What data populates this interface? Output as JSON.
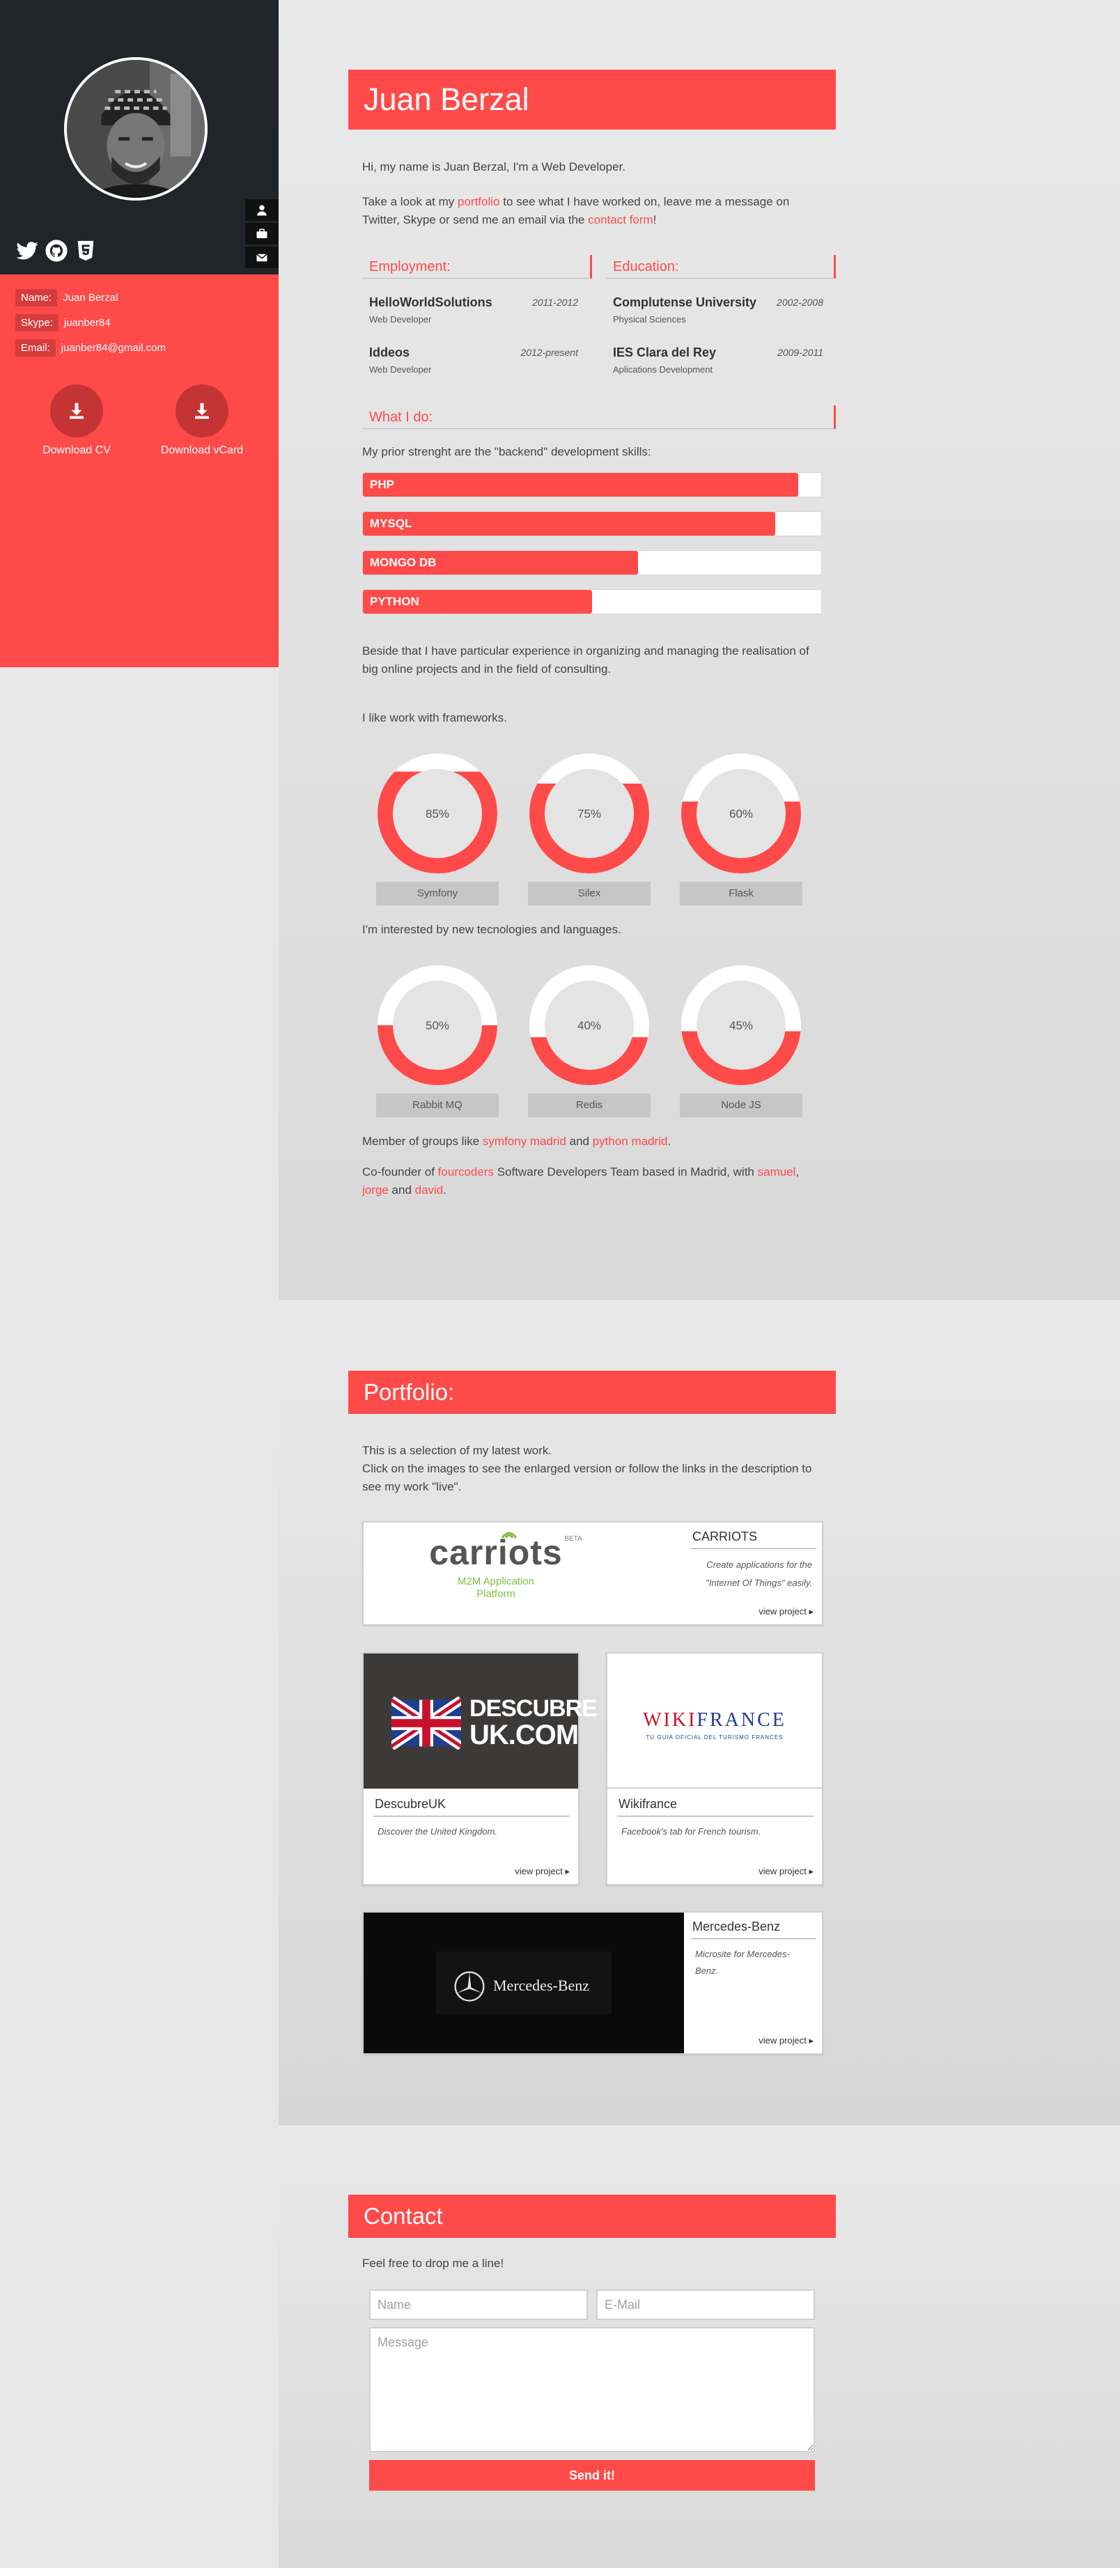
{
  "sidebar": {
    "name_label": "Name:",
    "name_value": "Juan Berzal",
    "skype_label": "Skype:",
    "skype_value": "juanber84",
    "email_label": "Email:",
    "email_value": "juanber84@gmail.com",
    "download_cv": "Download CV",
    "download_vcard": "Download vCard",
    "social_icons": [
      "twitter-icon",
      "github-icon",
      "html5-icon"
    ],
    "nav_icons": [
      "user-icon",
      "briefcase-icon",
      "envelope-icon"
    ]
  },
  "about": {
    "title": "Juan Berzal",
    "intro": "Hi, my name is Juan Berzal, I'm a Web Developer.",
    "take_look_1": "Take a look at my ",
    "take_look_link1": "portfolio",
    "take_look_2": " to see what I have worked on, leave me a message on Twitter, Skype or send me an email via the ",
    "take_look_link2": "contact form",
    "take_look_3": "!",
    "employment_heading": "Employment:",
    "education_heading": "Education:",
    "employment": [
      {
        "title": "HelloWorldSolutions",
        "years": "2011-2012",
        "role": "Web Developer"
      },
      {
        "title": "Iddeos",
        "years": "2012-present",
        "role": "Web Developer"
      }
    ],
    "education": [
      {
        "title": "Complutense University",
        "years": "2002-2008",
        "role": "Physical Sciences"
      },
      {
        "title": "IES Clara del Rey",
        "years": "2009-2011",
        "role": "Aplications Development"
      }
    ],
    "whatido_heading": "What I do:",
    "skills_intro": "My prior strenght are the \"backend\" development skills:",
    "skills": [
      {
        "name": "PHP",
        "percent": 95
      },
      {
        "name": "MYSQL",
        "percent": 90
      },
      {
        "name": "MONGO DB",
        "percent": 60
      },
      {
        "name": "PYTHON",
        "percent": 50
      }
    ],
    "experience": "Beside that I have particular experience in organizing and managing the realisation of big online projects and in the field of consulting.",
    "frameworks_intro": "I like work with frameworks.",
    "frameworks": [
      {
        "name": "Symfony",
        "percent_label": "85%",
        "percent": 85
      },
      {
        "name": "Silex",
        "percent_label": "75%",
        "percent": 75
      },
      {
        "name": "Flask",
        "percent_label": "60%",
        "percent": 60
      }
    ],
    "new_tech_intro": "I'm interested by new tecnologies and languages.",
    "new_tech": [
      {
        "name": "Rabbit MQ",
        "percent_label": "50%",
        "percent": 50
      },
      {
        "name": "Redis",
        "percent_label": "40%",
        "percent": 40
      },
      {
        "name": "Node JS",
        "percent_label": "45%",
        "percent": 45
      }
    ],
    "groups_1": "Member of groups like ",
    "groups_link1": "symfony madrid",
    "groups_2": " and ",
    "groups_link2": "python madrid",
    "groups_3": ".",
    "cofounder_1": "Co-founder of ",
    "cofounder_link1": "fourcoders",
    "cofounder_2": " Software Developers Team based in Madrid, with ",
    "cofounder_link2": "samuel",
    "cofounder_3": ",",
    "cofounder_link3": "jorge",
    "cofounder_4": " and ",
    "cofounder_link4": "david",
    "cofounder_5": "."
  },
  "portfolio": {
    "title": "Portfolio:",
    "intro_1": "This is a selection of my latest work.",
    "intro_2": "Click on the images to see the enlarged version or follow the links in the description to see my work \"live\".",
    "view_project": "view project",
    "carriots": {
      "logo": "carriots",
      "logo_beta": "BETA",
      "logo_sub": "M2M Application Platform",
      "title": "CARRIOTS",
      "desc": "Create applications for the \"Internet Of Things\" easily."
    },
    "descubre": {
      "logo_1": "DESCUBRE",
      "logo_2": "UK.COM",
      "title": "DescubreUK",
      "desc": "Discover the United Kingdom."
    },
    "wikifrance": {
      "logo": "WIKIFRANCE",
      "logo_sub": "TU GUIA OFICIAL DEL TURISMO FRANCES",
      "title": "Wikifrance",
      "desc": "Facebook's tab for French tourism."
    },
    "mercedes": {
      "logo": "Mercedes-Benz",
      "title": "Mercedes-Benz",
      "desc": "Microsite for Mercedes-Benz."
    }
  },
  "contact": {
    "title": "Contact",
    "intro": "Feel free to drop me a line!",
    "name_placeholder": "Name",
    "email_placeholder": "E-Mail",
    "message_placeholder": "Message",
    "send_label": "Send it!"
  },
  "colors": {
    "accent": "#ff4a4a",
    "dark": "#212529"
  }
}
